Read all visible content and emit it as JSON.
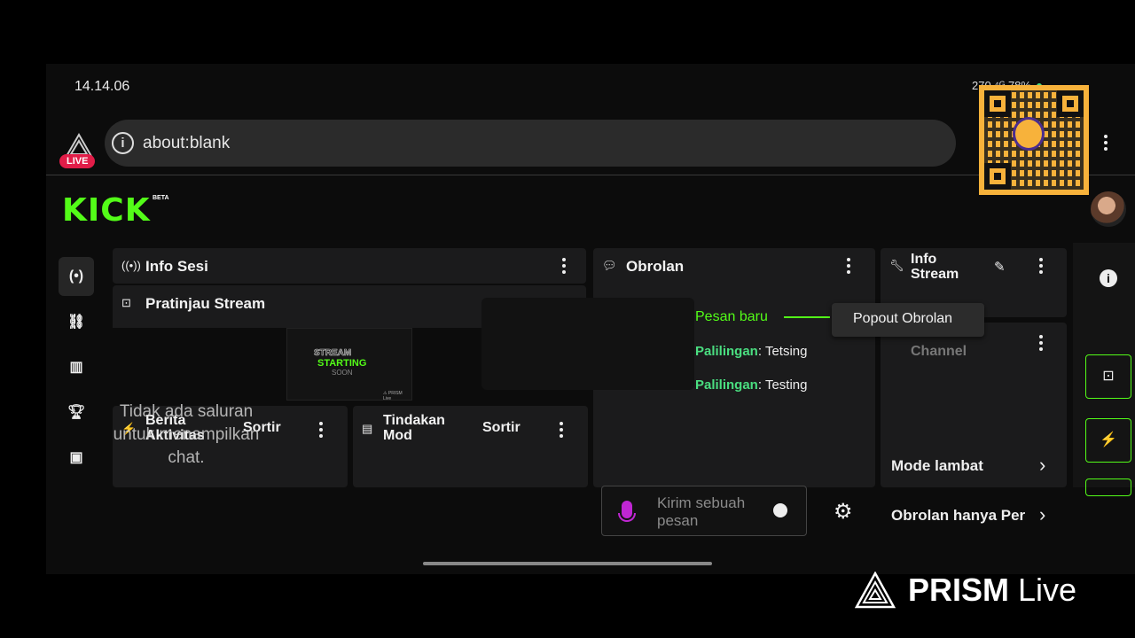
{
  "status": {
    "time": "14.14.06",
    "right_text": "270 ⁴ᴳ 78%"
  },
  "browser": {
    "url": "about:blank",
    "live_badge": "LIVE"
  },
  "kick": {
    "logo": "KICK",
    "beta": "BETA"
  },
  "panels": {
    "info_sesi": {
      "title": "Info Sesi"
    },
    "pratinjau": {
      "title": "Pratinjau Stream",
      "thumb_line1": "STREAM",
      "thumb_line2": "STARTING",
      "thumb_line3": "SOON",
      "thumb_line4": "⚠ PRISM Live"
    },
    "berita": {
      "title": "Berita Aktivitas",
      "sort": "Sortir"
    },
    "tindakan": {
      "title": "Tindakan Mod",
      "sort": "Sortir"
    },
    "obrolan": {
      "title": "Obrolan",
      "new_messages": "Pesan baru",
      "messages": [
        {
          "user": "Palilingan",
          "text": "Tetsing"
        },
        {
          "user": "Palilingan",
          "text": "Testing"
        }
      ],
      "input_placeholder": "Kirim sebuah pesan"
    },
    "info_stream": {
      "title": "Info Stream",
      "channel": "Channel",
      "rows": [
        "Mode lambat",
        "Obrolan hanya Per"
      ]
    }
  },
  "popout_label": "Popout Obrolan",
  "overlay_message": "Tidak ada saluran untuk menampilkan chat.",
  "brand": {
    "name": "PRISM",
    "suffix": "Live"
  }
}
